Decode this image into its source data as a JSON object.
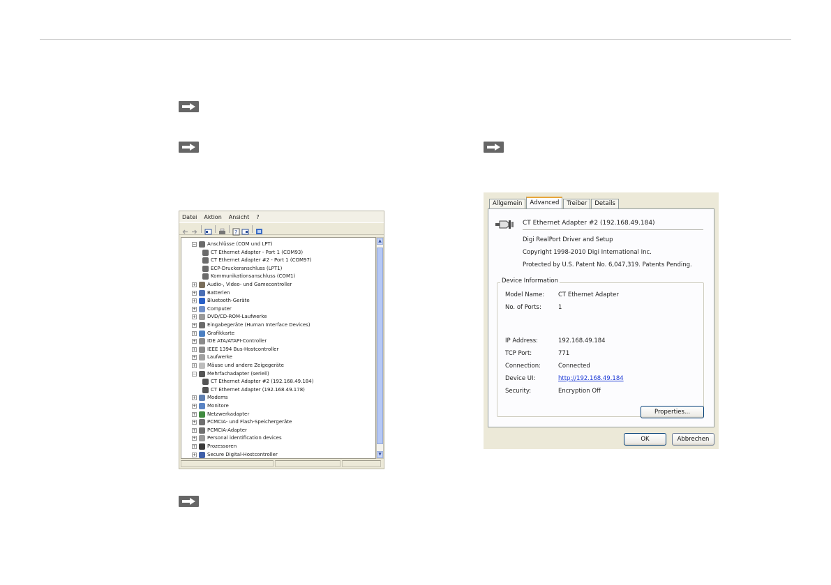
{
  "device_manager": {
    "menu": [
      "Datei",
      "Aktion",
      "Ansicht",
      "?"
    ],
    "toolbar_icons": [
      "back-icon",
      "forward-icon",
      "properties-icon",
      "print-icon",
      "help-icon",
      "view-icon",
      "scan-hardware-icon"
    ],
    "tree": [
      {
        "label": "Anschlüsse (COM und LPT)",
        "level": 0,
        "expander": "−",
        "icon": "port-icon",
        "color": "#6b6b6b"
      },
      {
        "label": "CT Ethernet Adapter - Port 1 (COM93)",
        "level": 1,
        "icon": "port-icon",
        "color": "#6b6b6b"
      },
      {
        "label": "CT Ethernet Adapter #2 - Port 1 (COM97)",
        "level": 1,
        "icon": "port-icon",
        "color": "#6b6b6b"
      },
      {
        "label": "ECP-Druckeranschluss (LPT1)",
        "level": 1,
        "icon": "port-icon",
        "color": "#6b6b6b"
      },
      {
        "label": "Kommunikationsanschluss (COM1)",
        "level": 1,
        "icon": "port-icon",
        "color": "#6b6b6b"
      },
      {
        "label": "Audio-, Video- und Gamecontroller",
        "level": 0,
        "expander": "+",
        "icon": "audio-icon",
        "color": "#7a6e5a"
      },
      {
        "label": "Batterien",
        "level": 0,
        "expander": "+",
        "icon": "battery-icon",
        "color": "#4a6fb5"
      },
      {
        "label": "Bluetooth-Geräte",
        "level": 0,
        "expander": "+",
        "icon": "bluetooth-icon",
        "color": "#2860c8"
      },
      {
        "label": "Computer",
        "level": 0,
        "expander": "+",
        "icon": "computer-icon",
        "color": "#6f8fc8"
      },
      {
        "label": "DVD/CD-ROM-Laufwerke",
        "level": 0,
        "expander": "+",
        "icon": "dvd-icon",
        "color": "#9a9a9a"
      },
      {
        "label": "Eingabegeräte (Human Interface Devices)",
        "level": 0,
        "expander": "+",
        "icon": "hid-icon",
        "color": "#6b6b6b"
      },
      {
        "label": "Grafikkarte",
        "level": 0,
        "expander": "+",
        "icon": "display-icon",
        "color": "#4b7fc1"
      },
      {
        "label": "IDE ATA/ATAPI-Controller",
        "level": 0,
        "expander": "+",
        "icon": "ide-icon",
        "color": "#8a8a8a"
      },
      {
        "label": "IEEE 1394 Bus-Hostcontroller",
        "level": 0,
        "expander": "+",
        "icon": "firewire-icon",
        "color": "#8a8a8a"
      },
      {
        "label": "Laufwerke",
        "level": 0,
        "expander": "+",
        "icon": "drive-icon",
        "color": "#a0a0a0"
      },
      {
        "label": "Mäuse und andere Zeigegeräte",
        "level": 0,
        "expander": "+",
        "icon": "mouse-icon",
        "color": "#bdbdbd"
      },
      {
        "label": "Mehrfachadapter (seriell)",
        "level": 0,
        "expander": "−",
        "icon": "serial-adapter-icon",
        "color": "#555555"
      },
      {
        "label": "CT Ethernet Adapter #2 (192.168.49.184)",
        "level": 1,
        "icon": "serial-adapter-icon",
        "color": "#555555"
      },
      {
        "label": "CT Ethernet Adapter (192.168.49.178)",
        "level": 1,
        "icon": "serial-adapter-icon",
        "color": "#555555"
      },
      {
        "label": "Modems",
        "level": 0,
        "expander": "+",
        "icon": "modem-icon",
        "color": "#5f7fb0"
      },
      {
        "label": "Monitore",
        "level": 0,
        "expander": "+",
        "icon": "monitor-icon",
        "color": "#5a84c4"
      },
      {
        "label": "Netzwerkadapter",
        "level": 0,
        "expander": "+",
        "icon": "network-icon",
        "color": "#3f8a3f"
      },
      {
        "label": "PCMCIA- und Flash-Speichergeräte",
        "level": 0,
        "expander": "+",
        "icon": "pcmcia-icon",
        "color": "#707070"
      },
      {
        "label": "PCMCIA-Adapter",
        "level": 0,
        "expander": "+",
        "icon": "pcmcia-icon",
        "color": "#707070"
      },
      {
        "label": "Personal identification devices",
        "level": 0,
        "expander": "+",
        "icon": "id-device-icon",
        "color": "#9a9a9a"
      },
      {
        "label": "Prozessoren",
        "level": 0,
        "expander": "+",
        "icon": "processor-icon",
        "color": "#3a3a3a"
      },
      {
        "label": "Secure Digital-Hostcontroller",
        "level": 0,
        "expander": "+",
        "icon": "sd-icon",
        "color": "#3f5fa8"
      }
    ]
  },
  "properties_dialog": {
    "tabs": [
      "Allgemein",
      "Advanced",
      "Treiber",
      "Details"
    ],
    "active_tab": "Advanced",
    "device_title": "CT Ethernet Adapter #2 (192.168.49.184)",
    "driver_lines": [
      "Digi RealPort Driver and Setup",
      "Copyright 1998-2010 Digi International Inc.",
      "Protected by U.S. Patent No. 6,047,319. Patents Pending."
    ],
    "group_label": "Device Information",
    "fields_top": [
      {
        "label": "Model Name:",
        "value": "CT Ethernet Adapter"
      },
      {
        "label": "No. of Ports:",
        "value": "1"
      }
    ],
    "fields_bottom": [
      {
        "label": "IP Address:",
        "value": "192.168.49.184"
      },
      {
        "label": "TCP Port:",
        "value": "771"
      },
      {
        "label": "Connection:",
        "value": "Connected"
      },
      {
        "label": "Device UI:",
        "value": "http://192.168.49.184",
        "link": true
      },
      {
        "label": "Security:",
        "value": "Encryption Off"
      }
    ],
    "properties_button": "Properties...",
    "ok_button": "OK",
    "cancel_button": "Abbrechen"
  }
}
